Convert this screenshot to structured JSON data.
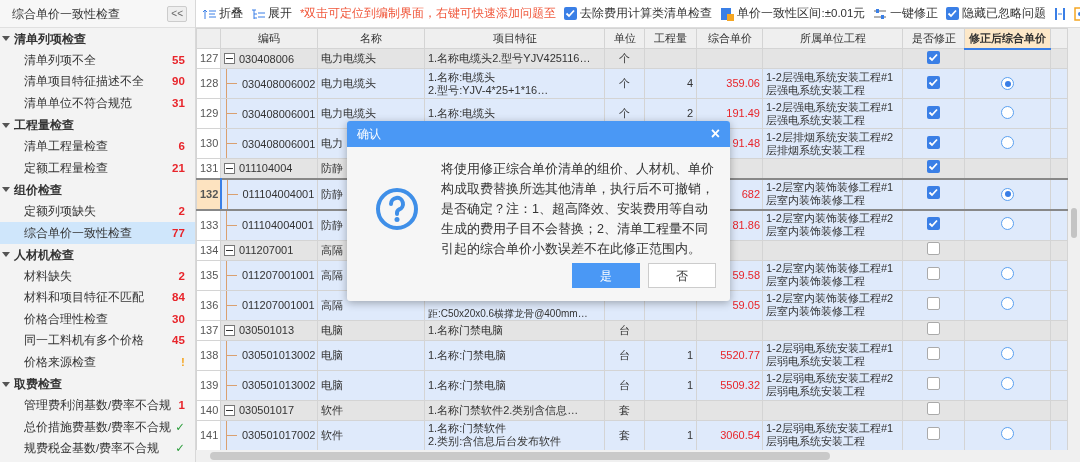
{
  "sidebar": {
    "title": "综合单价一致性检查",
    "collapse_label": "<<",
    "groups": [
      {
        "label": "清单列项检查",
        "expanded": true,
        "items": [
          {
            "label": "清单列项不全",
            "count": "55",
            "kind": "count",
            "selected": false
          },
          {
            "label": "清单项目特征描述不全",
            "count": "90",
            "kind": "count",
            "selected": false
          },
          {
            "label": "清单单位不符合规范",
            "count": "31",
            "kind": "count",
            "selected": false
          }
        ]
      },
      {
        "label": "工程量检查",
        "expanded": true,
        "items": [
          {
            "label": "清单工程量检查",
            "count": "6",
            "kind": "count",
            "selected": false
          },
          {
            "label": "定额工程量检查",
            "count": "21",
            "kind": "count",
            "selected": false
          }
        ]
      },
      {
        "label": "组价检查",
        "expanded": true,
        "items": [
          {
            "label": "定额列项缺失",
            "count": "2",
            "kind": "count",
            "selected": false
          },
          {
            "label": "综合单价一致性检查",
            "count": "77",
            "kind": "count",
            "selected": true
          }
        ]
      },
      {
        "label": "人材机检查",
        "expanded": true,
        "items": [
          {
            "label": "材料缺失",
            "count": "2",
            "kind": "count",
            "selected": false
          },
          {
            "label": "材料和项目特征不匹配",
            "count": "84",
            "kind": "count",
            "selected": false
          },
          {
            "label": "价格合理性检查",
            "count": "30",
            "kind": "count",
            "selected": false
          },
          {
            "label": "同一工料机有多个价格",
            "count": "45",
            "kind": "count",
            "selected": false
          },
          {
            "label": "价格来源检查",
            "count": "!",
            "kind": "warning",
            "selected": false
          }
        ]
      },
      {
        "label": "取费检查",
        "expanded": true,
        "items": [
          {
            "label": "管理费利润基数/费率不合规",
            "count": "1",
            "kind": "count",
            "selected": false
          },
          {
            "label": "总价措施费基数/费率不合规",
            "count": "✓",
            "kind": "ok",
            "selected": false
          },
          {
            "label": "规费税金基数/费率不合规",
            "count": "✓",
            "kind": "ok",
            "selected": false
          }
        ]
      }
    ]
  },
  "toolbar": {
    "collapse": "折叠",
    "expand": "展开",
    "notice": "*双击可定位到编制界面，右键可快速添加问题至",
    "exclude_fee": {
      "label": "去除费用计算类清单检查",
      "checked": true
    },
    "range": "单价一致性区间:±0.01元",
    "fix_all": "一键修正",
    "hide_ignored": {
      "label": "隐藏已忽略问题",
      "checked": true
    }
  },
  "table": {
    "columns": [
      "编码",
      "名称",
      "项目特征",
      "单位",
      "工程量",
      "综合单价",
      "所属单位工程",
      "是否修正",
      "修正后综合单价"
    ],
    "rows": [
      {
        "num": "127",
        "kind": "group",
        "expanded": true,
        "code": "030408006",
        "name": "电力电缆头",
        "feature": [
          "1.名称电缆头2.型号YJV425116…"
        ],
        "unit": "个",
        "fix": true,
        "selected": false
      },
      {
        "num": "128",
        "kind": "item",
        "code": "030408006002",
        "name": "电力电缆头",
        "feature": [
          "1.名称:电缆头",
          "2.型号:YJV-4*25+1*16…"
        ],
        "unit": "个",
        "qty": "4",
        "price": "359.06",
        "project": [
          "1-2层强电系统安装工程#1",
          "层强电系统安装工程"
        ],
        "fix": true,
        "chosen": true,
        "selected": false
      },
      {
        "num": "129",
        "kind": "item",
        "code": "030408006001",
        "name": "电力电缆头",
        "feature": [
          "1.名称:电缆头"
        ],
        "unit": "个",
        "qty": "2",
        "price": "191.49",
        "project": [
          "1-2层强电系统安装工程#1",
          "层强电系统安装工程"
        ],
        "fix": true,
        "chosen": false,
        "selected": false
      },
      {
        "num": "130",
        "kind": "item",
        "code": "030408006001",
        "name": "电力",
        "price": "91.48",
        "project": [
          "1-2层排烟系统安装工程#2",
          "层排烟系统安装工程"
        ],
        "fix": true,
        "chosen": false,
        "selected": false
      },
      {
        "num": "131",
        "kind": "group",
        "expanded": true,
        "code": "011104004",
        "name": "防静",
        "fix": true,
        "selected": false
      },
      {
        "num": "132",
        "kind": "item",
        "code": "011104004001",
        "name": "防静",
        "price": "682",
        "project": [
          "1-2层室内装饰装修工程#1",
          "层室内装饰装修工程"
        ],
        "fix": true,
        "chosen": true,
        "selected": true
      },
      {
        "num": "133",
        "kind": "item",
        "code": "011104004001",
        "name": "防静",
        "price": "81.86",
        "project": [
          "1-2层室内装饰装修工程#2",
          "层室内装饰装修工程"
        ],
        "fix": true,
        "chosen": false,
        "selected": false
      },
      {
        "num": "134",
        "kind": "group",
        "expanded": true,
        "code": "011207001",
        "name": "高隔",
        "fix": false,
        "selected": false
      },
      {
        "num": "135",
        "kind": "item",
        "code": "011207001001",
        "name": "高隔",
        "price": "59.58",
        "project": [
          "1-2层室内装饰装修工程#1",
          "层室内装饰装修工程"
        ],
        "fix": false,
        "chosen": false,
        "selected": false
      },
      {
        "num": "136",
        "kind": "item",
        "code": "011207001001",
        "name": "高隔",
        "feature_lower": "距:C50x20x0.6横撑龙骨@400mm…",
        "price": "59.05",
        "project": [
          "1-2层室内装饰装修工程#2",
          "层室内装饰装修工程"
        ],
        "fix": false,
        "chosen": false,
        "selected": false
      },
      {
        "num": "137",
        "kind": "group",
        "expanded": true,
        "code": "030501013",
        "name": "电脑",
        "feature": [
          "1.名称门禁电脑"
        ],
        "unit": "台",
        "fix": false,
        "selected": false
      },
      {
        "num": "138",
        "kind": "item",
        "code": "030501013002",
        "name": "电脑",
        "feature": [
          "1.名称:门禁电脑"
        ],
        "unit": "台",
        "qty": "1",
        "price": "5520.77",
        "project": [
          "1-2层弱电系统安装工程#1",
          "层弱电系统安装工程"
        ],
        "fix": false,
        "chosen": false,
        "selected": false
      },
      {
        "num": "139",
        "kind": "item",
        "code": "030501013002",
        "name": "电脑",
        "feature": [
          "1.名称:门禁电脑"
        ],
        "unit": "台",
        "qty": "1",
        "price": "5509.32",
        "project": [
          "1-2层弱电系统安装工程#2",
          "层弱电系统安装工程"
        ],
        "fix": false,
        "chosen": false,
        "selected": false
      },
      {
        "num": "140",
        "kind": "group",
        "expanded": true,
        "code": "030501017",
        "name": "软件",
        "feature": [
          "1.名称门禁软件2.类别含信息…"
        ],
        "unit": "套",
        "fix": false,
        "selected": false
      },
      {
        "num": "141",
        "kind": "item",
        "code": "030501017002",
        "name": "软件",
        "feature": [
          "1.名称:门禁软件",
          "2.类别:含信息后台发布软件"
        ],
        "unit": "套",
        "qty": "1",
        "price": "3060.54",
        "project": [
          "1-2层弱电系统安装工程#1",
          "层弱电系统安装工程"
        ],
        "fix": false,
        "chosen": false,
        "selected": false
      }
    ]
  },
  "dialog": {
    "title": "确认",
    "close": "×",
    "message": "将使用修正综合单价清单的组价、人材机、单价构成取费替换所选其他清单，执行后不可撤销，是否确定？注：1、超高降效、安装费用等自动生成的费用子目不会替换；2、清单工程量不同引起的综合单价小数误差不在此修正范围内。",
    "buttons": [
      {
        "label": "是",
        "kind": "primary"
      },
      {
        "label": "否",
        "kind": "secondary"
      }
    ]
  }
}
